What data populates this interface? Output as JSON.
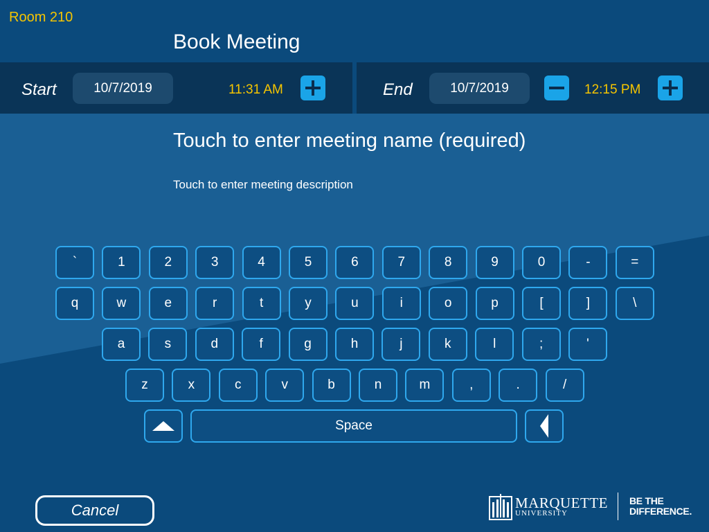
{
  "header": {
    "room": "Room 210",
    "title": "Book Meeting"
  },
  "start": {
    "label": "Start",
    "date": "10/7/2019",
    "time": "11:31 AM"
  },
  "end": {
    "label": "End",
    "date": "10/7/2019",
    "time": "12:15 PM"
  },
  "prompts": {
    "name": "Touch to enter meeting name (required)",
    "description": "Touch to enter meeting description"
  },
  "keyboard": {
    "row1": [
      "`",
      "1",
      "2",
      "3",
      "4",
      "5",
      "6",
      "7",
      "8",
      "9",
      "0",
      "-",
      "="
    ],
    "row2": [
      "q",
      "w",
      "e",
      "r",
      "t",
      "y",
      "u",
      "i",
      "o",
      "p",
      "[",
      "]",
      "\\"
    ],
    "row3": [
      "a",
      "s",
      "d",
      "f",
      "g",
      "h",
      "j",
      "k",
      "l",
      ";",
      "'"
    ],
    "row4": [
      "z",
      "x",
      "c",
      "v",
      "b",
      "n",
      "m",
      ",",
      ".",
      "/"
    ],
    "space_label": "Space",
    "shift_icon": "up-triangle-icon",
    "backspace_icon": "left-triangle-icon"
  },
  "footer": {
    "cancel_label": "Cancel",
    "logo_name": "MARQUETTE",
    "logo_sub": "UNIVERSITY",
    "slogan_line1": "BE THE",
    "slogan_line2": "DIFFERENCE."
  },
  "colors": {
    "background": "#0b4a7c",
    "bar": "#0a3457",
    "accent_gold": "#f6c500",
    "button_blue": "#1aa4e8",
    "key_border": "#2fa8ee"
  }
}
